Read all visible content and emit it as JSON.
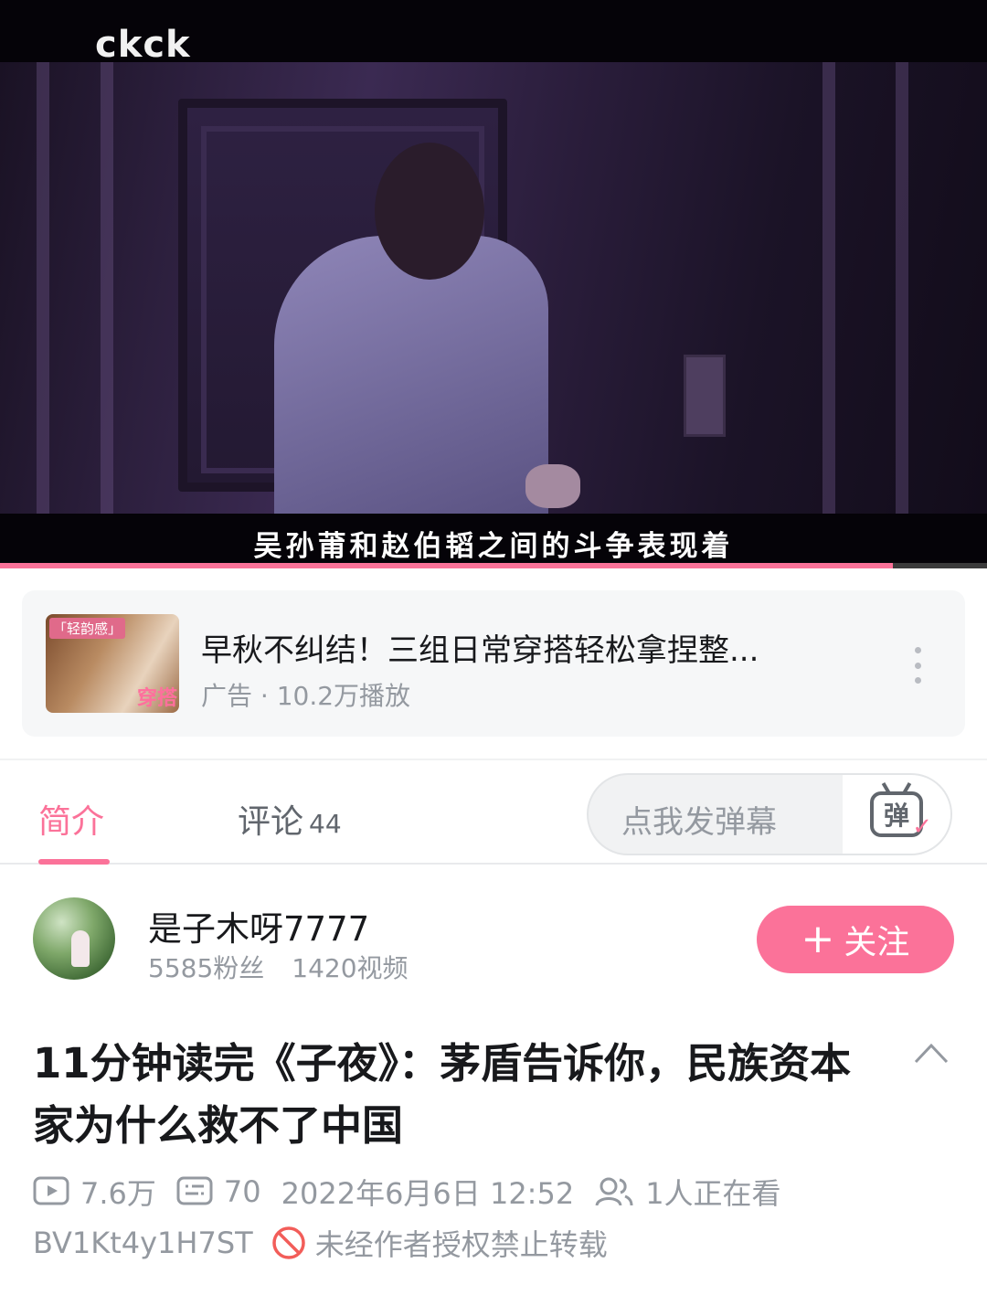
{
  "player": {
    "watermark": "ckck",
    "subtitle": "吴孙莆和赵伯韬之间的斗争表现着",
    "progress_fraction": 0.905
  },
  "ad": {
    "thumb_tag": "「轻韵感」",
    "thumb_text": "穿搭",
    "title": "早秋不纠结！三组日常穿搭轻松拿捏整...",
    "meta": "广告 · 10.2万播放"
  },
  "tabs": {
    "intro_label": "简介",
    "comments_label": "评论",
    "comments_count": "44"
  },
  "danmaku": {
    "placeholder": "点我发弹幕",
    "icon_glyph": "弹"
  },
  "uploader": {
    "name": "是子木呀7777",
    "fans": "5585粉丝",
    "videos": "1420视频",
    "follow_label": "关注"
  },
  "video": {
    "title": "11分钟读完《子夜》：茅盾告诉你，民族资本家为什么救不了中国",
    "plays": "7.6万",
    "danmaku_count": "70",
    "date": "2022年6月6日 12:52",
    "watching": "1人正在看",
    "bvid": "BV1Kt4y1H7ST",
    "no_repost": "未经作者授权禁止转载"
  },
  "colors": {
    "accent": "#fb7299",
    "muted": "#9499a0"
  }
}
